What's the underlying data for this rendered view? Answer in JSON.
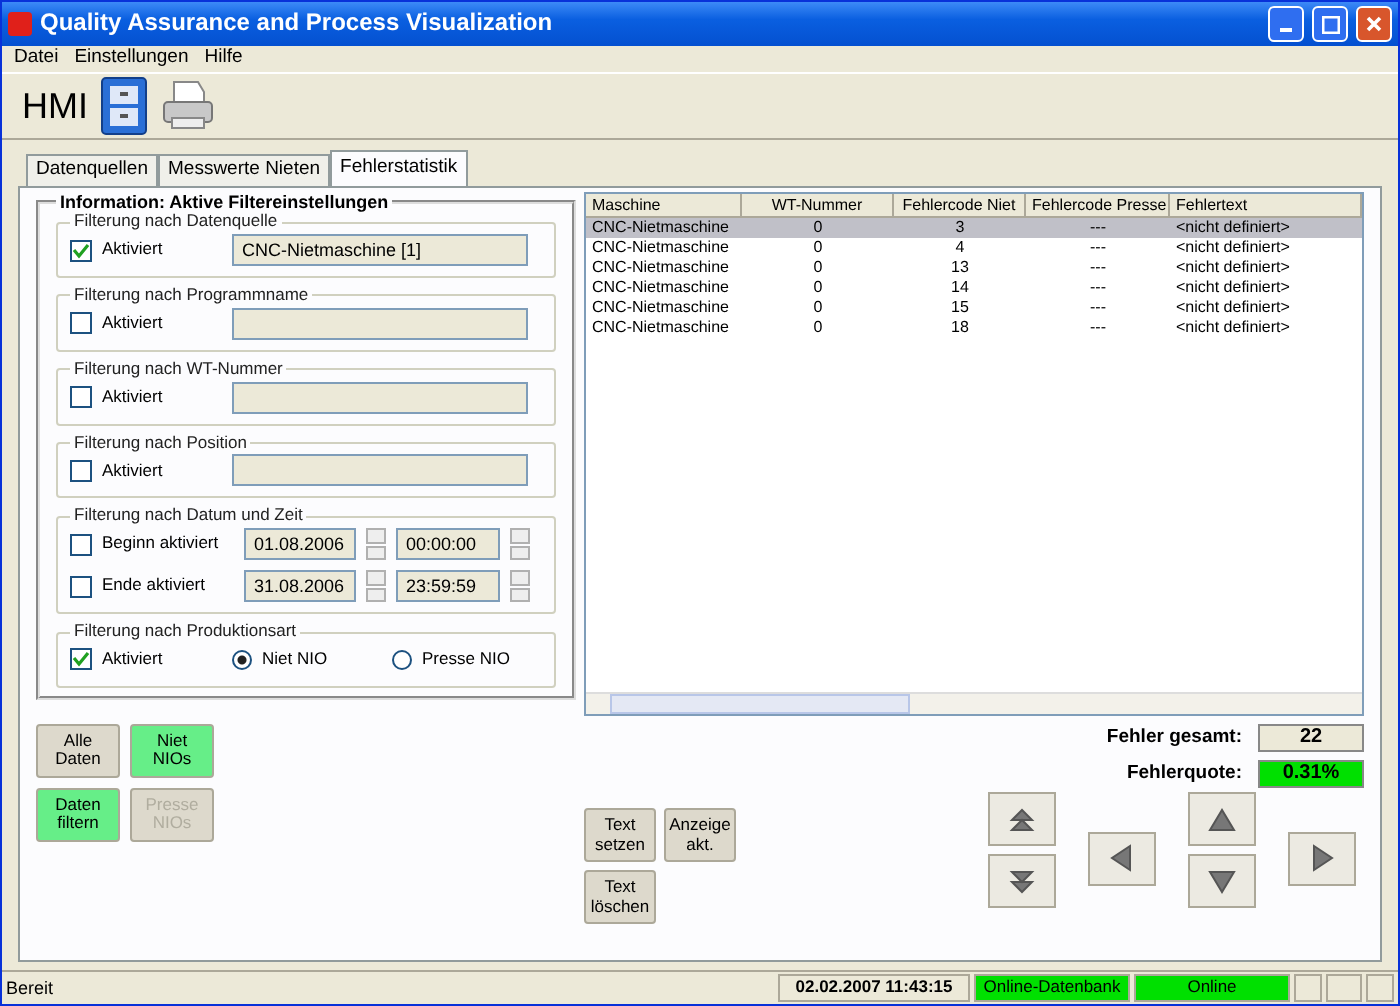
{
  "window": {
    "title": "Quality Assurance and Process Visualization"
  },
  "menu": [
    "Datei",
    "Einstellungen",
    "Hilfe"
  ],
  "toolbar": {
    "label": "HMI"
  },
  "tabs": [
    {
      "label": "Datenquellen",
      "selected": false
    },
    {
      "label": "Messwerte Nieten",
      "selected": false
    },
    {
      "label": "Fehlerstatistik",
      "selected": true
    }
  ],
  "filter_panel": {
    "title": "Information: Aktive Filtereinstellungen",
    "groups": [
      {
        "kind": "text",
        "title": "Filterung nach Datenquelle",
        "label": "Aktiviert",
        "checked": true,
        "value": "CNC-Nietmaschine [1]"
      },
      {
        "kind": "text",
        "title": "Filterung nach Programmname",
        "label": "Aktiviert",
        "checked": false
      },
      {
        "kind": "text",
        "title": "Filterung nach WT-Nummer",
        "label": "Aktiviert",
        "checked": false
      },
      {
        "kind": "text",
        "title": "Filterung nach Position",
        "label": "Aktiviert",
        "checked": false
      },
      {
        "kind": "datetime",
        "title": "Filterung nach Datum und Zeit",
        "rows": [
          {
            "label": "Beginn aktiviert",
            "checked": false,
            "date": "01.08.2006",
            "time": "00:00:00"
          },
          {
            "label": "Ende aktiviert",
            "checked": false,
            "date": "31.08.2006",
            "time": "23:59:59"
          }
        ]
      },
      {
        "kind": "radio",
        "title": "Filterung nach Produktionsart",
        "label": "Aktiviert",
        "checked": true,
        "options": [
          {
            "label": "Niet NIO",
            "selected": true
          },
          {
            "label": "Presse NIO",
            "selected": false
          }
        ]
      }
    ]
  },
  "filter_buttons": [
    {
      "label": "Alle\nDaten",
      "highlighted": false,
      "disabled": false
    },
    {
      "label": "Niet\nNIOs",
      "highlighted": true,
      "disabled": false
    },
    {
      "label": "Daten\nfiltern",
      "highlighted": true,
      "disabled": false
    },
    {
      "label": "Presse\nNIOs",
      "highlighted": false,
      "disabled": true
    }
  ],
  "table": {
    "columns": [
      "Maschine",
      "WT-Nummer",
      "Fehlercode Niet",
      "Fehlercode Presse",
      "Fehlertext"
    ],
    "rows": [
      {
        "cells": [
          "CNC-Nietmaschine",
          "0",
          "3",
          "---",
          "<nicht definiert>"
        ],
        "selected": true
      },
      {
        "cells": [
          "CNC-Nietmaschine",
          "0",
          "4",
          "---",
          "<nicht definiert>"
        ],
        "selected": false
      },
      {
        "cells": [
          "CNC-Nietmaschine",
          "0",
          "13",
          "---",
          "<nicht definiert>"
        ],
        "selected": false
      },
      {
        "cells": [
          "CNC-Nietmaschine",
          "0",
          "14",
          "---",
          "<nicht definiert>"
        ],
        "selected": false
      },
      {
        "cells": [
          "CNC-Nietmaschine",
          "0",
          "15",
          "---",
          "<nicht definiert>"
        ],
        "selected": false
      },
      {
        "cells": [
          "CNC-Nietmaschine",
          "0",
          "18",
          "---",
          "<nicht definiert>"
        ],
        "selected": false
      }
    ]
  },
  "summary": [
    {
      "label": "Fehler gesamt:",
      "value": "22",
      "highlighted": false
    },
    {
      "label": "Fehlerquote:",
      "value": "0.31%",
      "highlighted": true
    }
  ],
  "text_buttons": [
    "Text\nsetzen",
    "Anzeige\nakt.",
    "Text\nlöschen"
  ],
  "status_bar": {
    "message": "Bereit",
    "datetime": "02.02.2007 11:43:15",
    "indicators": [
      {
        "label": "Online-Datenbank",
        "color": "#00e000"
      },
      {
        "label": "Online",
        "color": "#00e000"
      }
    ]
  }
}
